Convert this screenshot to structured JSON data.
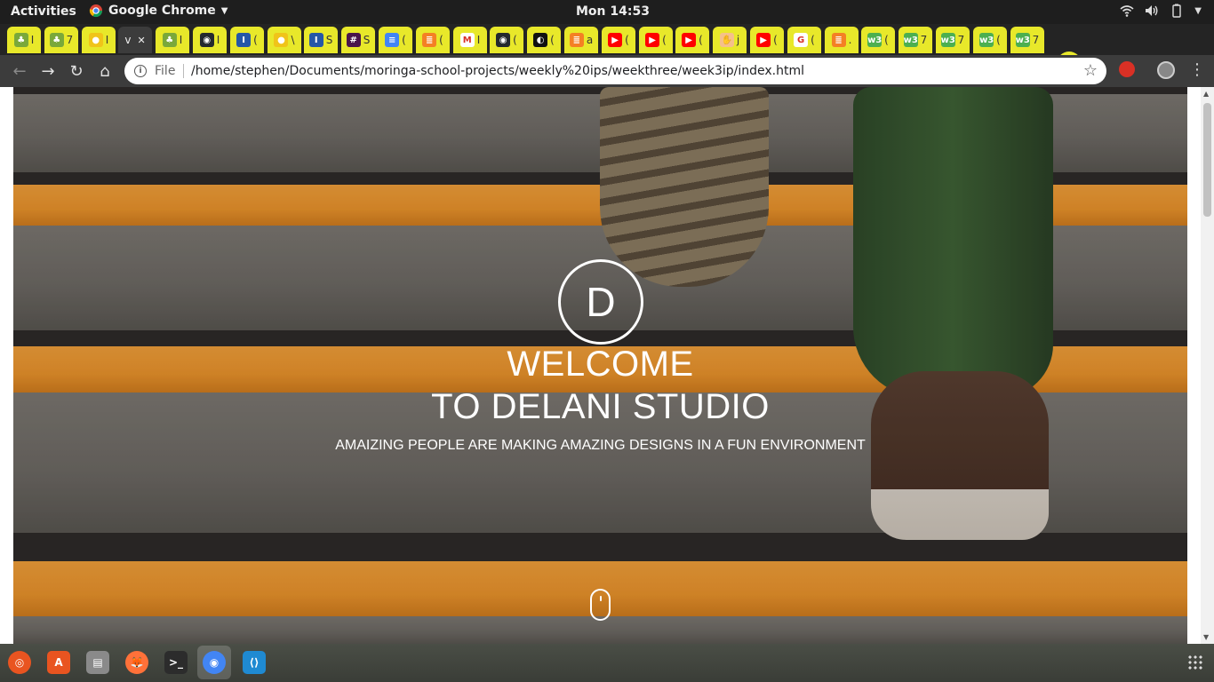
{
  "topbar": {
    "activities": "Activities",
    "app_name": "Google Chrome",
    "clock": "Mon 14:53"
  },
  "tabs": [
    {
      "icon": "plant-icon",
      "title": "I"
    },
    {
      "icon": "plant-icon",
      "title": "7"
    },
    {
      "icon": "globe-icon",
      "title": "I"
    },
    {
      "icon": "none",
      "title": "v",
      "active": true
    },
    {
      "icon": "plant-icon",
      "title": "I"
    },
    {
      "icon": "github-icon",
      "title": "I"
    },
    {
      "icon": "indeed-icon",
      "title": "("
    },
    {
      "icon": "globe-icon",
      "title": "\\"
    },
    {
      "icon": "indeed-icon",
      "title": "S"
    },
    {
      "icon": "slack-icon",
      "title": "S"
    },
    {
      "icon": "docs-icon",
      "title": "("
    },
    {
      "icon": "stackoverflow-icon",
      "title": "("
    },
    {
      "icon": "gmail-icon",
      "title": "I"
    },
    {
      "icon": "github-icon",
      "title": "("
    },
    {
      "icon": "codepen-icon",
      "title": "("
    },
    {
      "icon": "stackoverflow-icon",
      "title": "a"
    },
    {
      "icon": "youtube-icon",
      "title": "("
    },
    {
      "icon": "youtube-icon",
      "title": "("
    },
    {
      "icon": "youtube-icon",
      "title": "("
    },
    {
      "icon": "hand-icon",
      "title": "j"
    },
    {
      "icon": "youtube-icon",
      "title": "("
    },
    {
      "icon": "google-icon",
      "title": "("
    },
    {
      "icon": "stackoverflow-icon",
      "title": "."
    },
    {
      "icon": "w3schools-icon",
      "title": "("
    },
    {
      "icon": "w3schools-icon",
      "title": "7"
    },
    {
      "icon": "w3schools-icon",
      "title": "7"
    },
    {
      "icon": "w3schools-icon",
      "title": "("
    },
    {
      "icon": "w3schools-icon",
      "title": "7"
    }
  ],
  "toolbar": {
    "file_label": "File",
    "url": "/home/stephen/Documents/moringa-school-projects/weekly%20ips/weekthree/week3ip/index.html"
  },
  "hero": {
    "logo_letter": "D",
    "welcome_line1": "WELCOME",
    "welcome_line2": "TO DELANI STUDIO",
    "tagline": "AMAIZING PEOPLE ARE MAKING AMAZING DESIGNS IN A FUN ENVIRONMENT"
  },
  "dock": [
    {
      "name": "ubuntu-icon",
      "color": "#e95420"
    },
    {
      "name": "software-center-icon",
      "color": "#e95420"
    },
    {
      "name": "files-icon",
      "color": "#8a8a8a"
    },
    {
      "name": "firefox-icon",
      "color": "#ff7139"
    },
    {
      "name": "terminal-icon",
      "color": "#2c2c2c"
    },
    {
      "name": "chrome-icon",
      "color": "#4285f4",
      "active": true
    },
    {
      "name": "vscode-icon",
      "color": "#1f8ad2"
    }
  ],
  "colors": {
    "tab_yellow": "#e8e82a",
    "toolbar": "#3c3c3c",
    "step_orange": "#eb942c"
  }
}
